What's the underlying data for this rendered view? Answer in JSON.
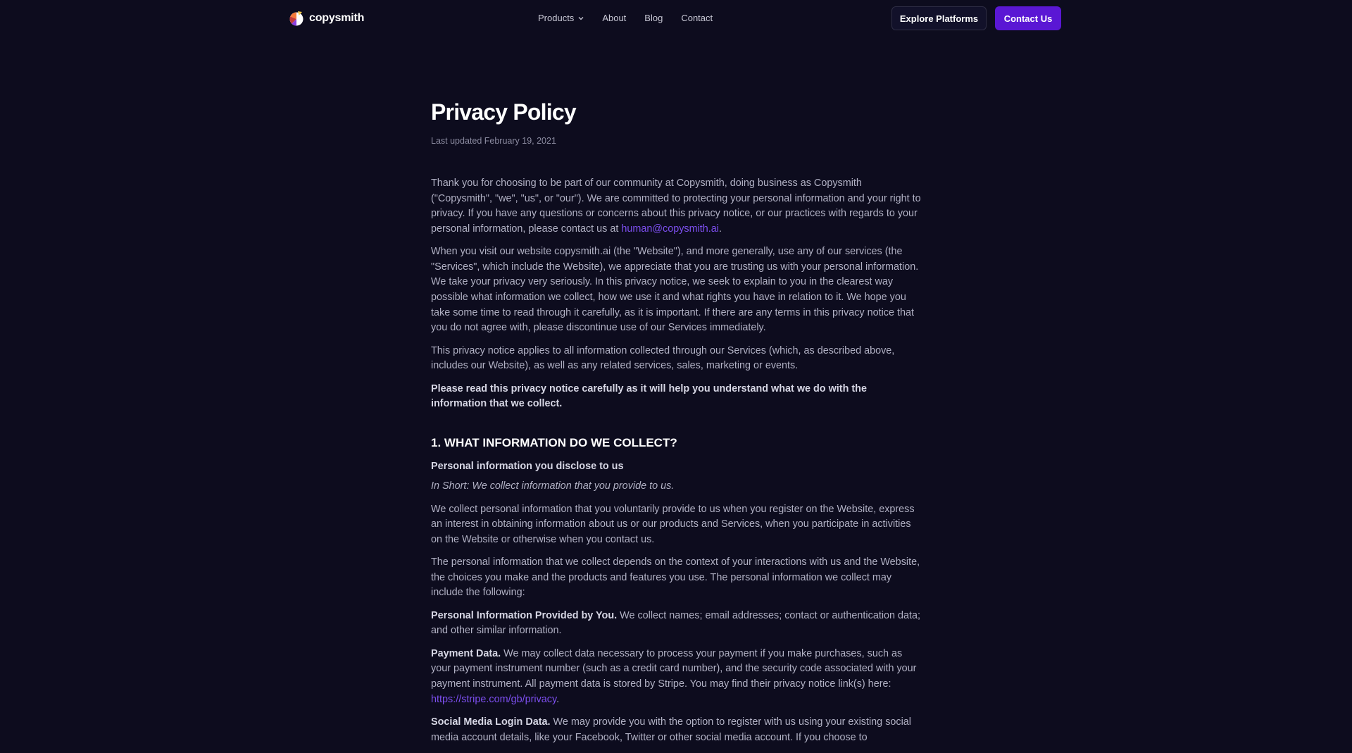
{
  "header": {
    "logo_text": "copysmith",
    "nav": [
      {
        "label": "Products"
      },
      {
        "label": "About"
      },
      {
        "label": "Blog"
      },
      {
        "label": "Contact"
      }
    ],
    "explore_label": "Explore Platforms",
    "contact_label": "Contact Us"
  },
  "page": {
    "title": "Privacy Policy",
    "updated": "Last updated February 19, 2021"
  },
  "body": {
    "p1_text": "Thank you for choosing to be part of our community at Copysmith, doing business as Copysmith (\"Copysmith\", \"we\", \"us\", or \"our\"). We are committed to protecting your personal information and your right to privacy. If you have any questions or concerns about this privacy notice, or our practices with regards to your personal information, please contact us at ",
    "p1_email": "human@copysmith.ai",
    "p2": "When you visit our website copysmith.ai (the \"Website\"), and more generally, use any of our services (the \"Services\", which include the Website), we appreciate that you are trusting us with your personal information. We take your privacy very seriously. In this privacy notice, we seek to explain to you in the clearest way possible what information we collect, how we use it and what rights you have in relation to it. We hope you take some time to read through it carefully, as it is important. If there are any terms in this privacy notice that you do not agree with, please discontinue use of our Services immediately.",
    "p3": "This privacy notice applies to all information collected through our Services (which, as described above, includes our Website), as well as any related services, sales, marketing or events.",
    "p4": "Please read this privacy notice carefully as it will help you understand what we do with the information that we collect.",
    "section1_heading": "1. WHAT INFORMATION DO WE COLLECT?",
    "sub1": "Personal information you disclose to us",
    "short1": "In Short: We collect information that you provide to us.",
    "p5": "We collect personal information that you voluntarily provide to us when you register on the Website, express an interest in obtaining information about us or our products and Services, when you participate in activities on the Website or otherwise when you contact us.",
    "p6": "The personal information that we collect depends on the context of your interactions with us and the Website, the choices you make and the products and features you use. The personal information we collect may include the following:",
    "p7_bold": "Personal Information Provided by You.",
    "p7_text": " We collect names; email addresses; contact or authentication data; and other similar information.",
    "p8_bold": "Payment Data.",
    "p8_text": " We may collect data necessary to process your payment if you make purchases, such as your payment instrument number (such as a credit card number), and the security code associated with your payment instrument. All payment data is stored by Stripe. You may find their privacy notice link(s) here: ",
    "p8_link": "https://stripe.com/gb/privacy",
    "p9_bold": "Social Media Login Data.",
    "p9_text": " We may provide you with the option to register with us using your existing social media account details, like your Facebook, Twitter or other social media account. If you choose to"
  }
}
